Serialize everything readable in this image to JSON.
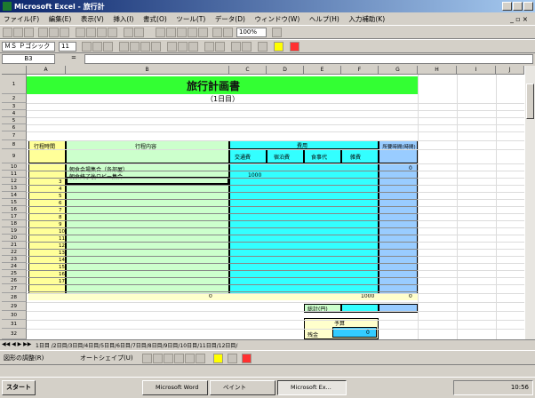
{
  "window": {
    "title": "Microsoft Excel - 旅行計"
  },
  "menu": [
    "ファイル(F)",
    "編集(E)",
    "表示(V)",
    "挿入(I)",
    "書式(O)",
    "ツール(T)",
    "データ(D)",
    "ウィンドウ(W)",
    "ヘルプ(H)",
    "入力補助(K)"
  ],
  "toolbar": {
    "font_name": "ＭＳ Ｐゴシック",
    "font_size": "11",
    "zoom": "100%"
  },
  "formula_bar": {
    "name_box": "B3",
    "fx": "="
  },
  "sheet": {
    "title": "旅行計画書",
    "subtitle": "（1日目）",
    "header_left": "行程時間",
    "header_middle": "行程内容",
    "header_cost": "費用",
    "header_cost_sub": [
      "交通費",
      "宿泊費",
      "食事代",
      "雑費",
      "合計"
    ],
    "header_time": "所要時間(時間)",
    "rows": [
      {
        "no": "",
        "text": "朝食会場集合（各部屋）"
      },
      {
        "no": "",
        "text": "朝食終了後ロビー集合"
      }
    ],
    "first_cost": "1000",
    "first_total": "0",
    "row_numbers": [
      "3",
      "4",
      "5",
      "6",
      "7",
      "8",
      "9",
      "10",
      "11",
      "12",
      "13",
      "14",
      "15",
      "16",
      "17"
    ],
    "sum_label": "0",
    "sum_total": "1000",
    "sum_time": "0",
    "box_label": "総計(円)",
    "box2_title": "予算",
    "box2_label": "残金",
    "box2_value": "0"
  },
  "tabs": "1日目 /2日目/3日目/4日目/5日目/6日目/7日目/8日目/9日目/10日目/11日目/12日目/",
  "drawing": {
    "draw_label": "図形の調整(R)",
    "autoshape_label": "オートシェイプ(U)"
  },
  "taskbar": {
    "start": "スタート",
    "tasks": [
      "Microsoft Word",
      "ペイント",
      "Microsoft Ex..."
    ],
    "clock": "10:56"
  }
}
